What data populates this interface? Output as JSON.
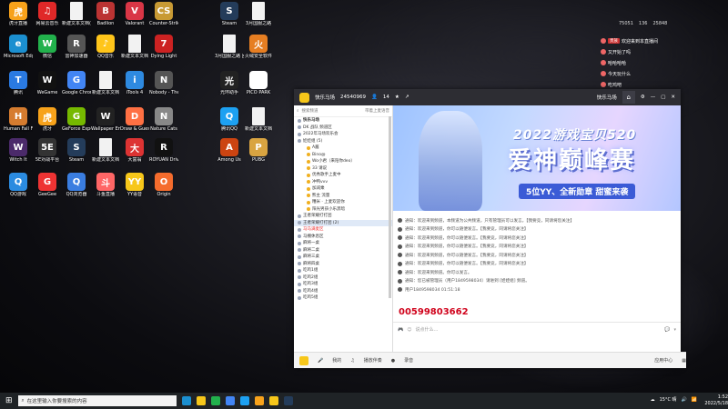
{
  "desktop_icons": [
    {
      "label": "虎牙直播",
      "color": "#f7a21b",
      "glyph": "虎"
    },
    {
      "label": "网易云音乐",
      "color": "#e02828",
      "glyph": "♫"
    },
    {
      "label": "新建文本文档(2)",
      "color": "#f2f2f2",
      "glyph": "",
      "file": true
    },
    {
      "label": "Badlion",
      "color": "#b33",
      "glyph": "B"
    },
    {
      "label": "Valorant",
      "color": "#d93646",
      "glyph": "V"
    },
    {
      "label": "Counter-Strike",
      "color": "#c89a34",
      "glyph": "CS"
    },
    {
      "label": "Steam",
      "color": "#243c5a",
      "glyph": "S"
    },
    {
      "label": "3月国服之路",
      "color": "#f2f2f2",
      "glyph": "",
      "file": true
    },
    {
      "label": "Microsoft Edge",
      "color": "#1b8fd0",
      "glyph": "e"
    },
    {
      "label": "微信",
      "color": "#22b14c",
      "glyph": "W"
    },
    {
      "label": "雷神加速器",
      "color": "#555",
      "glyph": "R"
    },
    {
      "label": "QQ音乐",
      "color": "#ffc51a",
      "glyph": "♪"
    },
    {
      "label": "新建文本文档",
      "color": "#f2f2f2",
      "glyph": "",
      "file": true
    },
    {
      "label": "Dying Light",
      "color": "#c22",
      "glyph": "7"
    },
    {
      "label": "3月国服之路 回顾",
      "color": "#f2f2f2",
      "glyph": "",
      "file": true
    },
    {
      "label": "火绒安全软件",
      "color": "#e67e22",
      "glyph": "火"
    },
    {
      "label": "腾讯",
      "color": "#2a7ae2",
      "glyph": "T"
    },
    {
      "label": "WeGame",
      "color": "#111",
      "glyph": "W"
    },
    {
      "label": "Google Chrome",
      "color": "#4285f4",
      "glyph": "G"
    },
    {
      "label": "新建文本文档",
      "color": "#f2f2f2",
      "glyph": "",
      "file": true
    },
    {
      "label": "iTools 4",
      "color": "#2e8ae0",
      "glyph": "i"
    },
    {
      "label": "Nobody - The Turnaround",
      "color": "#555",
      "glyph": "N"
    },
    {
      "label": "光环助手",
      "color": "#222",
      "glyph": "光"
    },
    {
      "label": "PICO PARK",
      "color": "#fff",
      "glyph": "P"
    },
    {
      "label": "Human Fall Flat",
      "color": "#d67c2f",
      "glyph": "H"
    },
    {
      "label": "虎牙",
      "color": "#f7a21b",
      "glyph": "虎"
    },
    {
      "label": "GeForce Experience",
      "color": "#76b900",
      "glyph": "G"
    },
    {
      "label": "Wallpaper Engine",
      "color": "#222",
      "glyph": "W"
    },
    {
      "label": "Draw & Guess",
      "color": "#ff7043",
      "glyph": "D"
    },
    {
      "label": "Nature Cats",
      "color": "#888",
      "glyph": "N"
    },
    {
      "label": "腾讯QQ",
      "color": "#1da1f2",
      "glyph": "Q"
    },
    {
      "label": "新建文本文档",
      "color": "#f2f2f2",
      "glyph": "",
      "file": true
    },
    {
      "label": "Witch It",
      "color": "#4b2a6a",
      "glyph": "W"
    },
    {
      "label": "5E对战平台",
      "color": "#333",
      "glyph": "5E"
    },
    {
      "label": "Steam",
      "color": "#243c5a",
      "glyph": "S"
    },
    {
      "label": "新建文本文档",
      "color": "#f2f2f2",
      "glyph": "",
      "file": true
    },
    {
      "label": "大富翁",
      "color": "#d33",
      "glyph": "大"
    },
    {
      "label": "ROYUAN Driver",
      "color": "#111",
      "glyph": "R"
    },
    {
      "label": "Among Us",
      "color": "#c41",
      "glyph": "A"
    },
    {
      "label": "PUBG",
      "color": "#d9a441",
      "glyph": "P"
    },
    {
      "label": "QQ游戏",
      "color": "#2b8be0",
      "glyph": "Q"
    },
    {
      "label": "GeeGee",
      "color": "#e33",
      "glyph": "G"
    },
    {
      "label": "QQ浏览器",
      "color": "#3a7de0",
      "glyph": "Q"
    },
    {
      "label": "斗鱼直播",
      "color": "#f66",
      "glyph": "斗"
    },
    {
      "label": "YY语音",
      "color": "#f7c71a",
      "glyph": "YY"
    },
    {
      "label": "Origin",
      "color": "#f56c2d",
      "glyph": "O"
    }
  ],
  "right_panel": {
    "top_stats": [
      "75051",
      "136",
      "25848"
    ],
    "chat": [
      {
        "tag": "贵族",
        "text": "欢迎来到本直播间"
      },
      {
        "tag": "",
        "text": "又开始了吗"
      },
      {
        "tag": "",
        "text": "哈哈哈哈"
      },
      {
        "tag": "",
        "text": "今天玩什么"
      },
      {
        "tag": "",
        "text": "吃鸡吧"
      },
      {
        "tag": "",
        "text": "……"
      }
    ]
  },
  "yy_window": {
    "title": "快乐马场",
    "channel_id": "24540969",
    "online_count": "14",
    "top_right_label": "快乐马场",
    "left_toolbar": [
      "搜索频道",
      "带着上麦语音"
    ],
    "channel_tree": [
      {
        "text": "快乐马场",
        "cls": "bold"
      },
      {
        "text": "DK 战队 频道区",
        "cls": ""
      },
      {
        "text": "2022年马场欢乐会",
        "cls": ""
      },
      {
        "text": "娃娃组 (5)",
        "cls": ""
      },
      {
        "text": "A酱",
        "cls": "user"
      },
      {
        "text": "Bino@",
        "cls": "user"
      },
      {
        "text": "Wo小君（来陪你deo）",
        "cls": "user"
      },
      {
        "text": "33 请说",
        "cls": "user"
      },
      {
        "text": "优秀歌手上麦中",
        "cls": "user"
      },
      {
        "text": "冲鸭vvv",
        "cls": "user"
      },
      {
        "text": "加减乘",
        "cls": "user"
      },
      {
        "text": "熊主 流量",
        "cls": "user"
      },
      {
        "text": "糟米 · 上麦欢迎你",
        "cls": "user"
      },
      {
        "text": "阳光男孩小乐黑暗",
        "cls": "user"
      },
      {
        "text": "王者荣耀打打团",
        "cls": ""
      },
      {
        "text": "王者荣耀打打团 (2)",
        "cls": "hi"
      },
      {
        "text": "马马满麦区",
        "cls": "red"
      },
      {
        "text": "马棚休息区",
        "cls": ""
      },
      {
        "text": "麻将一桌",
        "cls": ""
      },
      {
        "text": "麻将二桌",
        "cls": ""
      },
      {
        "text": "麻将三桌",
        "cls": ""
      },
      {
        "text": "麻将四桌",
        "cls": ""
      },
      {
        "text": "吃鸡1组",
        "cls": ""
      },
      {
        "text": "吃鸡2组",
        "cls": ""
      },
      {
        "text": "吃鸡3组",
        "cls": ""
      },
      {
        "text": "吃鸡4组",
        "cls": ""
      },
      {
        "text": "吃鸡5组",
        "cls": ""
      }
    ],
    "banner": {
      "subtitle": "2022游戏宝贝520",
      "title": "爱神巅峰赛",
      "tagline": "5位YY、全新勋章 甜蜜来袭"
    },
    "messages": [
      {
        "text": "通知：欢迎来到频道，本频道为公共频道，只有管理员可以发言。【我要竞，同请将您关注】"
      },
      {
        "text": "通知：欢迎来到频道，你可以随便发言。【我要竞，同请将您关注】"
      },
      {
        "text": "通知：欢迎来到频道，你可以随便发言。【我要竞，同请将您关注】"
      },
      {
        "text": "通知：欢迎来到频道，你可以随便发言。【我要竞，同请将您关注】"
      },
      {
        "text": "通知：欢迎来到频道，你可以随便发言。【我要竞，同请将您关注】"
      },
      {
        "text": "通知：欢迎来到频道，你可以随便发言。【我要竞，同请将您关注】"
      },
      {
        "text": "通知：欢迎来到频道。你可以发言。"
      },
      {
        "text": "通知：您已被管理员（用户1849598034）请进到 [娃娃组] 频道。"
      },
      {
        "text": "用户1849598034 01:51:18"
      }
    ],
    "big_number": "00599803662",
    "input_placeholder": "说点什么…",
    "bottom_bar": [
      "我的",
      "播放伴奏",
      "录音",
      "应用中心"
    ]
  },
  "taskbar": {
    "search_placeholder": "在这里输入你要搜索的内容",
    "weather": "15°C 晴",
    "time": "1:52",
    "date": "2022/5/18"
  }
}
